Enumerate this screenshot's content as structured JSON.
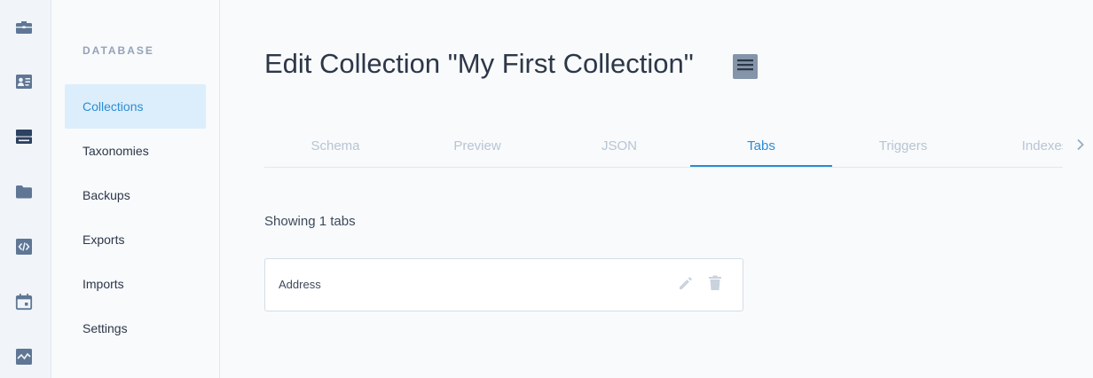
{
  "rail": {
    "icons": [
      "briefcase-icon",
      "id-card-icon",
      "database-icon",
      "folder-icon",
      "code-icon",
      "calendar-icon",
      "activity-chart-icon"
    ],
    "active": "database-icon",
    "icon_color": "#5f7795",
    "active_icon_color": "#2d4161"
  },
  "sidebar": {
    "heading": "DATABASE",
    "items": [
      {
        "label": "Collections",
        "active": true
      },
      {
        "label": "Taxonomies"
      },
      {
        "label": "Backups"
      },
      {
        "label": "Exports"
      },
      {
        "label": "Imports"
      },
      {
        "label": "Settings"
      }
    ]
  },
  "header": {
    "title": "Edit Collection \"My First Collection\"",
    "menu_icon": "hamburger-menu-icon"
  },
  "tabs": [
    {
      "label": "Schema"
    },
    {
      "label": "Preview"
    },
    {
      "label": "JSON"
    },
    {
      "label": "Tabs",
      "active": true
    },
    {
      "label": "Triggers"
    },
    {
      "label": "Indexes"
    }
  ],
  "content": {
    "showing": "Showing 1 tabs",
    "tab_items": [
      {
        "name": "Address",
        "actions": [
          "pencil-edit-icon",
          "trash-icon"
        ]
      }
    ]
  },
  "colors": {
    "accent": "#2b8cd6",
    "active_bg": "#dceefb",
    "muted_tab": "#b8c5d3",
    "action_icon": "#c9d3de"
  }
}
